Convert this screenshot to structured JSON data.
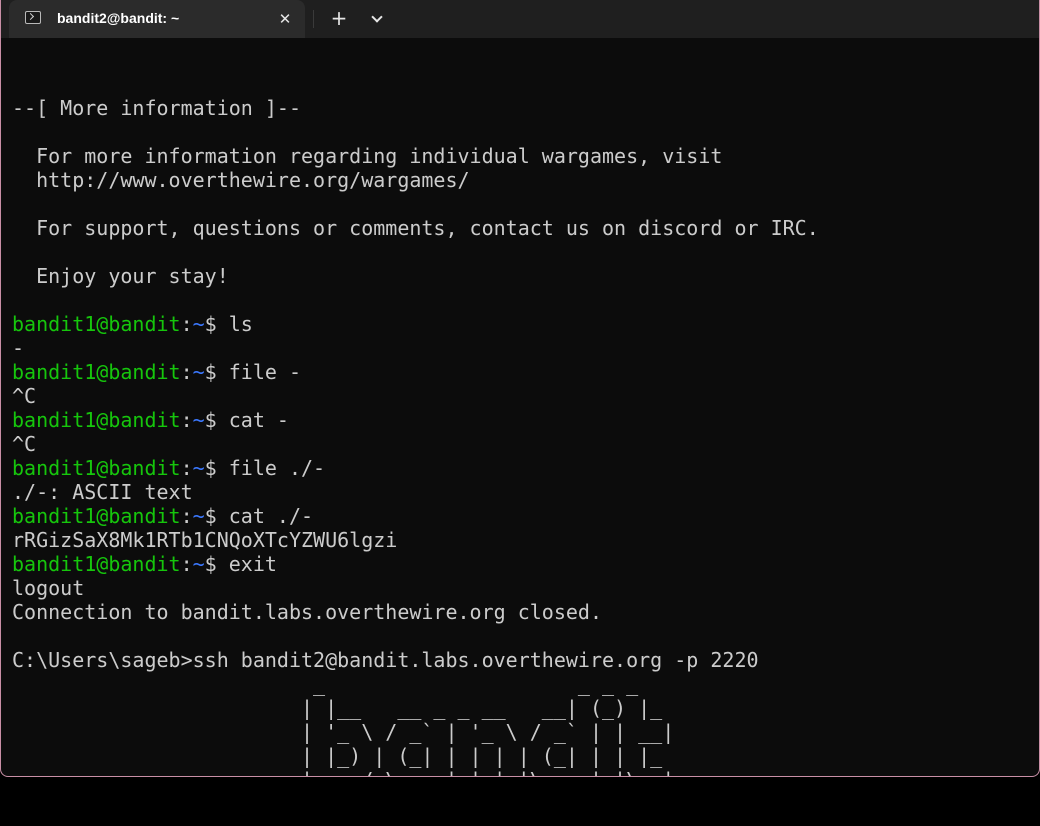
{
  "window": {
    "tab_title": "bandit2@bandit: ~",
    "close_glyph": "✕",
    "new_tab_glyph": "+",
    "dropdown_icon": "chevron-down-icon",
    "tab_icon": "terminal-icon"
  },
  "colors": {
    "background": "#0c0c0c",
    "prompt_user": "#16c60c",
    "prompt_path": "#3b78ff",
    "text": "#cccccc",
    "window_border": "#c98fa6"
  },
  "terminal": {
    "lines": [
      {
        "type": "text",
        "text": ""
      },
      {
        "type": "text",
        "text": "--[ More information ]--"
      },
      {
        "type": "text",
        "text": ""
      },
      {
        "type": "text",
        "text": "  For more information regarding individual wargames, visit"
      },
      {
        "type": "text",
        "text": "  http://www.overthewire.org/wargames/"
      },
      {
        "type": "text",
        "text": ""
      },
      {
        "type": "text",
        "text": "  For support, questions or comments, contact us on discord or IRC."
      },
      {
        "type": "text",
        "text": ""
      },
      {
        "type": "text",
        "text": "  Enjoy your stay!"
      },
      {
        "type": "text",
        "text": ""
      },
      {
        "type": "prompt",
        "user": "bandit1@bandit",
        "path": "~",
        "command": "ls"
      },
      {
        "type": "text",
        "text": "-"
      },
      {
        "type": "prompt",
        "user": "bandit1@bandit",
        "path": "~",
        "command": "file -"
      },
      {
        "type": "text",
        "text": "^C"
      },
      {
        "type": "prompt",
        "user": "bandit1@bandit",
        "path": "~",
        "command": "cat -"
      },
      {
        "type": "text",
        "text": "^C"
      },
      {
        "type": "prompt",
        "user": "bandit1@bandit",
        "path": "~",
        "command": "file ./-"
      },
      {
        "type": "text",
        "text": "./-: ASCII text"
      },
      {
        "type": "prompt",
        "user": "bandit1@bandit",
        "path": "~",
        "command": "cat ./-"
      },
      {
        "type": "text",
        "text": "rRGizSaX8Mk1RTb1CNQoXTcYZWU6lgzi"
      },
      {
        "type": "prompt",
        "user": "bandit1@bandit",
        "path": "~",
        "command": "exit"
      },
      {
        "type": "text",
        "text": "logout"
      },
      {
        "type": "text",
        "text": "Connection to bandit.labs.overthewire.org closed."
      },
      {
        "type": "text",
        "text": ""
      },
      {
        "type": "text",
        "text": "C:\\Users\\sageb>ssh bandit2@bandit.labs.overthewire.org -p 2220"
      },
      {
        "type": "text",
        "text": "                         _                     _ _ _"
      },
      {
        "type": "text",
        "text": "                        | |__   __ _ _ __   __| (_) |_"
      },
      {
        "type": "text",
        "text": "                        | '_ \\ / _` | '_ \\ / _` | | __|"
      },
      {
        "type": "text",
        "text": "                        | |_) | (_| | | | | (_| | | |_"
      },
      {
        "type": "text",
        "text": "                        |_.__/ \\__,_|_| |_|\\__,_|_|\\__|"
      }
    ]
  }
}
